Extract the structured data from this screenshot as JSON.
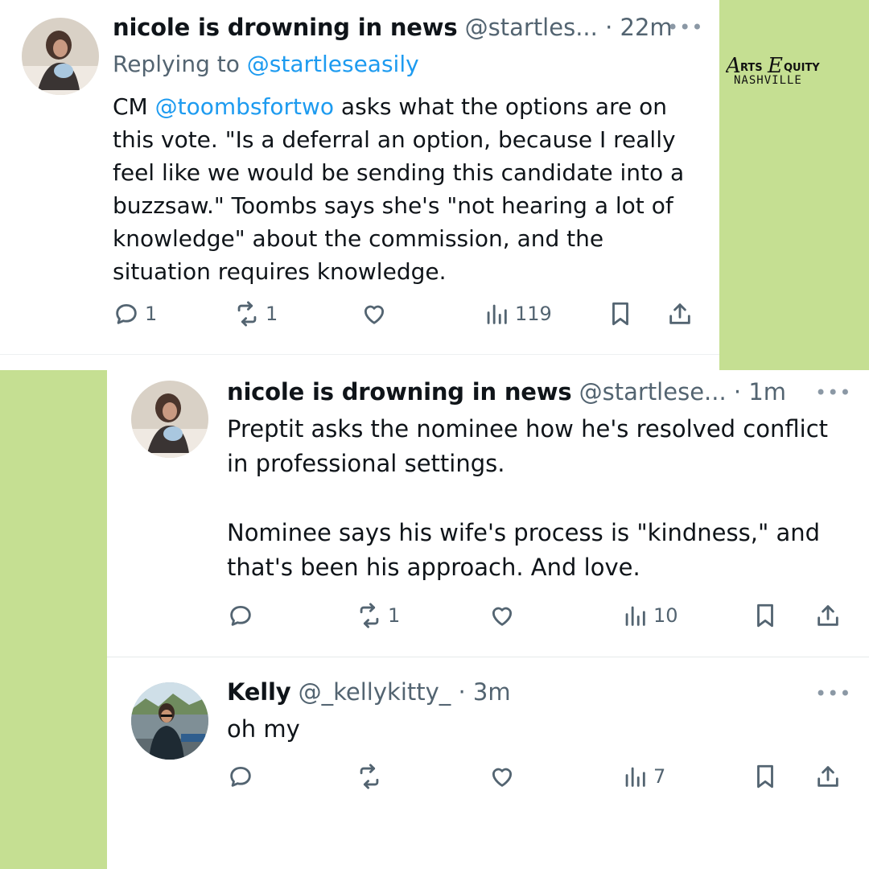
{
  "colors": {
    "accent": "#1d9bf0",
    "muted": "#536471",
    "background_panel": "#c5df92"
  },
  "logo": {
    "line1": "ARTS EQUITY",
    "line2": "NASHVILLE"
  },
  "tweets": [
    {
      "name": "nicole is drowning in news",
      "handle": "@startles...",
      "time": "· 22m",
      "replying_prefix": "Replying to",
      "replying_handle": "@startleseasily",
      "text_prefix": "CM",
      "mention": "@toombsfortwo",
      "text_rest": "asks what the options are on this vote. \"Is a deferral an option, because I really feel like we would be sending this candidate into a buzzsaw.\" Toombs says she's \"not hearing a lot of knowledge\" about the commission, and the situation requires knowledge.",
      "reply_count": "1",
      "retweet_count": "1",
      "like_count": "",
      "views": "119"
    },
    {
      "name": "nicole is drowning in news",
      "handle": "@startlese...",
      "time": "· 1m",
      "paragraph1": "Preptit asks the nominee how he's resolved conflict in professional settings.",
      "paragraph2": "Nominee says his wife's process is \"kindness,\" and that's been his approach. And love.",
      "reply_count": "",
      "retweet_count": "1",
      "like_count": "",
      "views": "10"
    },
    {
      "name": "Kelly",
      "handle": "@_kellykitty_",
      "time": "· 3m",
      "text": "oh my",
      "reply_count": "",
      "retweet_count": "",
      "like_count": "",
      "views": "7"
    }
  ]
}
